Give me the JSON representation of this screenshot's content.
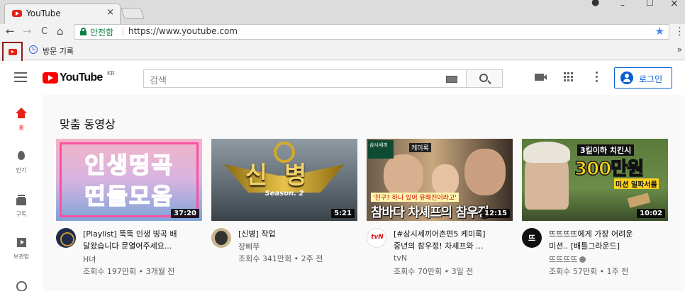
{
  "browser": {
    "tab_title": "YouTube",
    "tab_close": "×",
    "window_controls": [
      "–",
      "☐",
      "×"
    ],
    "nav": {
      "back": "←",
      "forward": "→",
      "reload": "C",
      "home": "⌂"
    },
    "secure_label": "안전함",
    "url": "https://www.youtube.com",
    "star": "★",
    "menu": "⋮",
    "bookmarks": {
      "history_label": "방문 기록",
      "more": "»"
    }
  },
  "masthead": {
    "logo_text": "YouTube",
    "logo_region": "KR",
    "search_placeholder": "검색",
    "login_label": "로그인"
  },
  "guide": {
    "items": [
      {
        "label": "홈",
        "icon": "home-icon",
        "active": true
      },
      {
        "label": "인기",
        "icon": "fire-icon"
      },
      {
        "label": "구독",
        "icon": "subscriptions-icon"
      },
      {
        "label": "보관함",
        "icon": "library-icon"
      },
      {
        "label": "",
        "icon": "history-icon"
      }
    ]
  },
  "main": {
    "section_title": "맞춤 동영상",
    "videos": [
      {
        "thumb_line1": "인생띵곡",
        "thumb_line2": "띤들모음",
        "duration": "37:20",
        "title_line1": "[Playlist] 뚝뚝 인생 띵곡 배",
        "title_line2": "달왔습니다 문열어주세요...",
        "channel": "H녀",
        "stats": "조회수 197만회 • 3개월 전"
      },
      {
        "thumb_text": "신병",
        "thumb_sub": "Season. 2",
        "duration": "5:21",
        "title_line1": "[신병] 작업",
        "title_line2": "",
        "channel": "장삐쭈",
        "stats": "조회수 341만회 • 2주 전"
      },
      {
        "thumb_badge": "삼시세끼",
        "thumb_tag": "케미록",
        "thumb_caption": "'친구? 하나 있어 유해진이라고'",
        "thumb_text": "참바다 차셰프의 참우정",
        "duration": "12:15",
        "title_line1": "[#삼시세끼어촌편5 케미록]",
        "title_line2": "중년의 참우정! 차셰프와 ...",
        "channel": "tvN",
        "channel_avatar_text": "tvN",
        "stats": "조회수 70만회 • 3일 전"
      },
      {
        "thumb_sign1": "3킬이하 치킨시",
        "thumb_sign2": "300만원",
        "thumb_sign3": "미션 일파서를",
        "duration": "10:02",
        "title_line1": "뜨뜨뜨뜨에게 가장 어려운",
        "title_line2": "미션.. [배틀그라운드]",
        "channel": "뜨뜨뜨뜨",
        "channel_avatar_text": "뜨",
        "verified": true,
        "stats": "조회수 57만회 • 1주 전"
      }
    ]
  }
}
